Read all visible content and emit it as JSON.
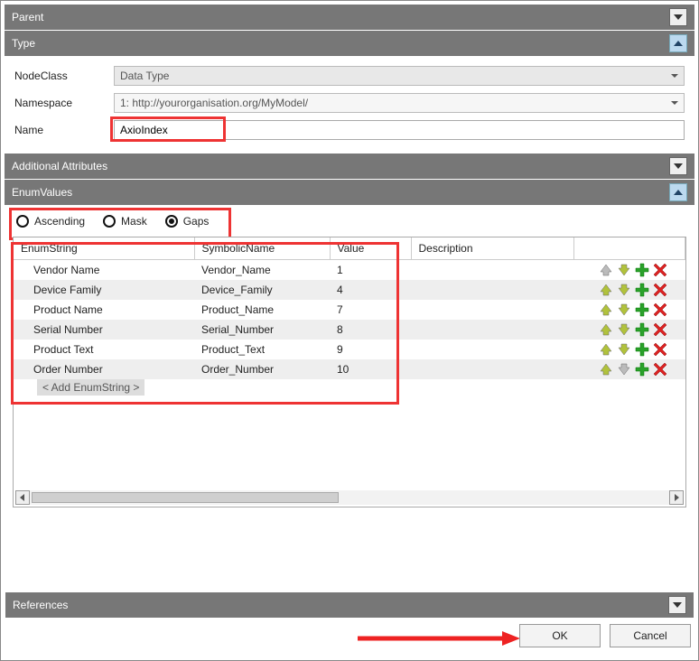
{
  "sections": {
    "parent": "Parent",
    "type": "Type",
    "additional": "Additional Attributes",
    "enumvalues": "EnumValues",
    "references": "References"
  },
  "type_form": {
    "labels": {
      "nodeclass": "NodeClass",
      "namespace": "Namespace",
      "name": "Name"
    },
    "nodeclass_value": "Data Type",
    "namespace_value": "1: http://yourorganisation.org/MyModel/",
    "name_value": "AxioIndex"
  },
  "sort_options": {
    "ascending": "Ascending",
    "mask": "Mask",
    "gaps": "Gaps",
    "selected": "gaps"
  },
  "enum_table": {
    "headers": {
      "enumstring": "EnumString",
      "symbolic": "SymbolicName",
      "value": "Value",
      "description": "Description"
    },
    "rows": [
      {
        "enum": "Vendor Name",
        "sym": "Vendor_Name",
        "val": "1",
        "desc": ""
      },
      {
        "enum": "Device Family",
        "sym": "Device_Family",
        "val": "4",
        "desc": ""
      },
      {
        "enum": "Product Name",
        "sym": "Product_Name",
        "val": "7",
        "desc": ""
      },
      {
        "enum": "Serial Number",
        "sym": "Serial_Number",
        "val": "8",
        "desc": ""
      },
      {
        "enum": "Product Text",
        "sym": "Product_Text",
        "val": "9",
        "desc": ""
      },
      {
        "enum": "Order Number",
        "sym": "Order_Number",
        "val": "10",
        "desc": ""
      }
    ],
    "add_label": "< Add EnumString >"
  },
  "row_actions": {
    "up_enabled_color": "#b1c23c",
    "up_disabled_color": "#bbbbbb",
    "down_enabled_color": "#b1c23c",
    "down_disabled_color": "#bbbbbb",
    "plus_color": "#2aa12a",
    "x_color": "#d22"
  },
  "footer": {
    "ok": "OK",
    "cancel": "Cancel"
  }
}
